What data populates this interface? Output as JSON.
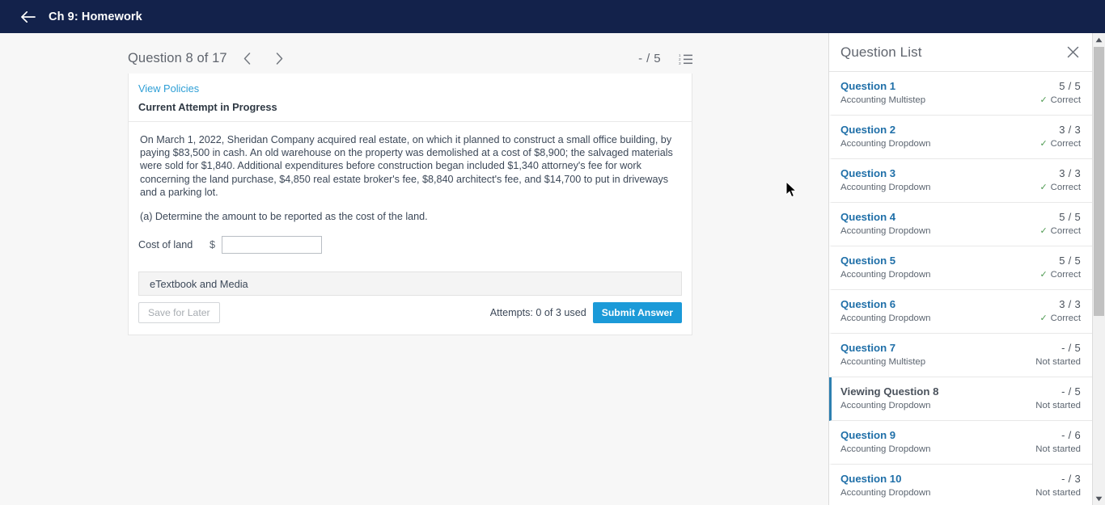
{
  "topbar": {
    "back_icon": "arrow-left-icon",
    "course_title": "Ch 9: Homework"
  },
  "question_header": {
    "title": "Question 8 of 17",
    "prev_icon": "chevron-left-icon",
    "next_icon": "chevron-right-icon",
    "score": "- / 5",
    "list_icon": "ordered-list-icon"
  },
  "question_card": {
    "view_policies_label": "View Policies",
    "attempt_status": "Current Attempt in Progress",
    "body_paragraph": "On March 1, 2022, Sheridan Company acquired real estate, on which it planned to construct a small office building, by paying $83,500 in cash. An old warehouse on the property was demolished at a cost of $8,900; the salvaged materials were sold for $1,840. Additional expenditures before construction began included $1,340 attorney's fee for work concerning the land purchase, $4,850 real estate broker's fee, $8,840 architect's fee, and $14,700 to put in driveways and a parking lot.",
    "prompt": "(a) Determine the amount to be reported as the cost of the land.",
    "answer_label": "Cost of land",
    "currency_symbol": "$",
    "answer_value": "",
    "answer_placeholder": "",
    "etextbook_label": "eTextbook and Media",
    "save_for_later_label": "Save for Later",
    "attempts_text": "Attempts: 0 of 3 used",
    "submit_label": "Submit Answer"
  },
  "question_list": {
    "title": "Question List",
    "close_icon": "close-icon",
    "items": [
      {
        "name": "Question 1",
        "type": "Accounting Multistep",
        "score": "5 / 5",
        "state": "Correct",
        "correct": true,
        "active": false
      },
      {
        "name": "Question 2",
        "type": "Accounting Dropdown",
        "score": "3 / 3",
        "state": "Correct",
        "correct": true,
        "active": false
      },
      {
        "name": "Question 3",
        "type": "Accounting Dropdown",
        "score": "3 / 3",
        "state": "Correct",
        "correct": true,
        "active": false
      },
      {
        "name": "Question 4",
        "type": "Accounting Dropdown",
        "score": "5 / 5",
        "state": "Correct",
        "correct": true,
        "active": false
      },
      {
        "name": "Question 5",
        "type": "Accounting Dropdown",
        "score": "5 / 5",
        "state": "Correct",
        "correct": true,
        "active": false
      },
      {
        "name": "Question 6",
        "type": "Accounting Dropdown",
        "score": "3 / 3",
        "state": "Correct",
        "correct": true,
        "active": false
      },
      {
        "name": "Question 7",
        "type": "Accounting Multistep",
        "score": "- / 5",
        "state": "Not started",
        "correct": false,
        "active": false
      },
      {
        "name": "Viewing Question 8",
        "type": "Accounting Dropdown",
        "score": "- / 5",
        "state": "Not started",
        "correct": false,
        "active": true
      },
      {
        "name": "Question 9",
        "type": "Accounting Dropdown",
        "score": "- / 6",
        "state": "Not started",
        "correct": false,
        "active": false
      },
      {
        "name": "Question 10",
        "type": "Accounting Dropdown",
        "score": "- / 3",
        "state": "Not started",
        "correct": false,
        "active": false
      }
    ]
  },
  "scrollbar": {
    "up_icon": "scroll-up-arrow-icon",
    "down_icon": "scroll-down-arrow-icon",
    "thumb": "scrollbar-thumb"
  },
  "colors": {
    "topbar": "#13224b",
    "link": "#1f6fa8",
    "accent_blue": "#1b9ad8",
    "active_marker": "#2c7fb0",
    "correct_green": "#4e9a51",
    "page_bg": "#f7f7f7"
  }
}
